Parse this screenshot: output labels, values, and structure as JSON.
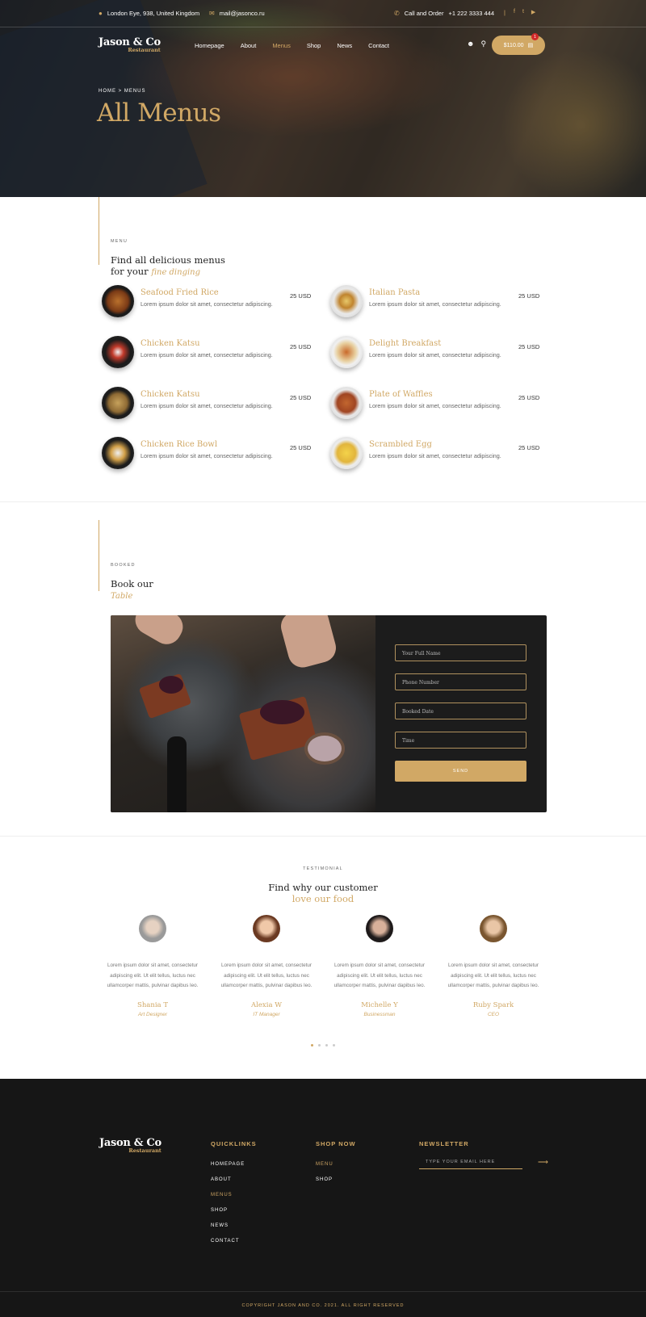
{
  "topbar": {
    "address": "London Eye, 938, United Kingdom",
    "email": "mail@jasonco.ru",
    "call_label": "Call and Order",
    "phone": "+1 222 3333 444",
    "separator": "|"
  },
  "brand": {
    "name": "Jason & Co",
    "sub": "Restaurant"
  },
  "nav": {
    "items": [
      "Homepage",
      "About",
      "Menus",
      "Shop",
      "News",
      "Contact"
    ],
    "active": "Menus"
  },
  "cart": {
    "total": "$110.00",
    "count": "1"
  },
  "hero": {
    "breadcrumb": "HOME > MENUS",
    "title": "All Menus"
  },
  "menu_section": {
    "eyebrow": "MENU",
    "heading_1": "Find all delicious menus",
    "heading_2": "for your",
    "heading_em": "fine dinging",
    "items": [
      {
        "name": "Seafood Fried Rice",
        "desc": "Lorem ipsum dolor sit amet, consectetur adipiscing.",
        "price": "25 USD"
      },
      {
        "name": "Italian Pasta",
        "desc": "Lorem ipsum dolor sit amet, consectetur adipiscing.",
        "price": "25 USD"
      },
      {
        "name": "Chicken Katsu",
        "desc": "Lorem ipsum dolor sit amet, consectetur adipiscing.",
        "price": "25 USD"
      },
      {
        "name": "Delight Breakfast",
        "desc": "Lorem ipsum dolor sit amet, consectetur adipiscing.",
        "price": "25 USD"
      },
      {
        "name": "Chicken Katsu",
        "desc": "Lorem ipsum dolor sit amet, consectetur adipiscing.",
        "price": "25 USD"
      },
      {
        "name": "Plate of Waffles",
        "desc": "Lorem ipsum dolor sit amet, consectetur adipiscing.",
        "price": "25 USD"
      },
      {
        "name": "Chicken Rice Bowl",
        "desc": "Lorem ipsum dolor sit amet, consectetur adipiscing.",
        "price": "25 USD"
      },
      {
        "name": "Scrambled Egg",
        "desc": "Lorem ipsum dolor sit amet, consectetur adipiscing.",
        "price": "25 USD"
      }
    ]
  },
  "booking": {
    "eyebrow": "BOOKED",
    "heading_1": "Book our",
    "heading_em": "Table",
    "fields": [
      "Your Full Name",
      "Phone Number",
      "Booked Date",
      "Time"
    ],
    "send": "SEND"
  },
  "testimonial": {
    "eyebrow": "TESTIMONIAL",
    "heading_1": "Find why our customer",
    "heading_em": "love our food",
    "items": [
      {
        "l1": "Lorem ipsum dolor sit amet, consectetur",
        "l2": "adipiscing elit. Ut elit tellus, luctus nec",
        "l3": "ullamcorper mattis, pulvinar dapibus leo.",
        "name": "Shania T",
        "role": "Art Designer"
      },
      {
        "l1": "Lorem ipsum dolor sit amet, consectetur",
        "l2": "adipiscing elit. Ut elit tellus, luctus nec",
        "l3": "ullamcorper mattis, pulvinar dapibus leo.",
        "name": "Alexia W",
        "role": "IT Manager"
      },
      {
        "l1": "Lorem ipsum dolor sit amet, consectetur",
        "l2": "adipiscing elit. Ut elit tellus, luctus nec",
        "l3": "ullamcorper mattis, pulvinar dapibus leo.",
        "name": "Michelle Y",
        "role": "Businessman"
      },
      {
        "l1": "Lorem ipsum dolor sit amet, consectetur",
        "l2": "adipiscing elit. Ut elit tellus, luctus nec",
        "l3": "ullamcorper mattis, pulvinar dapibus leo.",
        "name": "Ruby Spark",
        "role": "CEO"
      }
    ]
  },
  "footer": {
    "quicklinks_title": "QUICKLINKS",
    "quicklinks": [
      "HOMEPAGE",
      "ABOUT",
      "MENUS",
      "SHOP",
      "NEWS",
      "CONTACT"
    ],
    "shop_title": "SHOP NOW",
    "shop_links": [
      "MENU",
      "SHOP"
    ],
    "newsletter_title": "NEWSLETTER",
    "newsletter_placeholder": "TYPE YOUR EMAIL HERE",
    "copyright": "COPYRIGHT JASON AND CO. 2021. ALL RIGHT RESERVED"
  },
  "colors": {
    "accent": "#d1a865",
    "dark": "#161616",
    "badge": "#d02a2a"
  }
}
